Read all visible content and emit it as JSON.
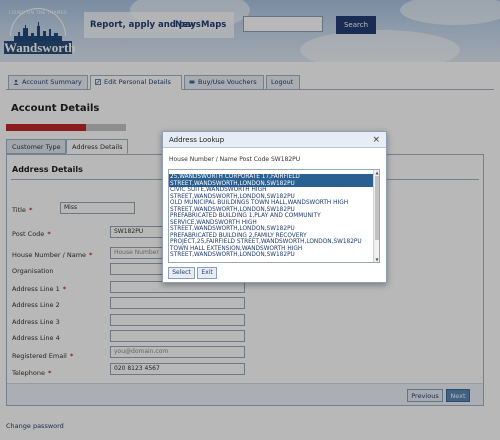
{
  "header": {
    "logo_arc_text": "LIVING ON THE THAMES",
    "logo_name": "Wandsworth",
    "links": [
      "Report, apply and pay",
      "News",
      "Maps"
    ],
    "search_button": "Search",
    "search_placeholder": ""
  },
  "main_nav": {
    "tabs": [
      {
        "label": "Account Summary",
        "icon": "person-icon"
      },
      {
        "label": "Edit Personal Details",
        "icon": "edit-icon"
      },
      {
        "label": "Buy/Use Vouchers",
        "icon": "voucher-icon"
      },
      {
        "label": "Logout",
        "icon": ""
      }
    ],
    "active_index": 1
  },
  "page_title": "Account Details",
  "progress": {
    "fraction": 0.67,
    "fill_color": "#c0282d"
  },
  "form_tabs": [
    "Customer Type",
    "Address Details"
  ],
  "form": {
    "section_title": "Address Details",
    "fields": [
      {
        "label": "Title",
        "required": true,
        "value": "Miss"
      },
      {
        "label": "Post Code",
        "required": true,
        "value": "SW182PU"
      },
      {
        "label": "House Number / Name",
        "required": true,
        "placeholder": "House Number"
      },
      {
        "label": "Organisation",
        "required": false,
        "value": ""
      },
      {
        "label": "Address Line 1",
        "required": true,
        "value": ""
      },
      {
        "label": "Address Line 2",
        "required": false,
        "value": ""
      },
      {
        "label": "Address Line 3",
        "required": false,
        "value": ""
      },
      {
        "label": "Address Line 4",
        "required": false,
        "value": ""
      },
      {
        "label": "Registered Email",
        "required": true,
        "placeholder": "you@domain.com"
      },
      {
        "label": "Telephone",
        "required": true,
        "value": "020 8123 4567"
      }
    ],
    "buttons": {
      "previous": "Previous",
      "next": "Next"
    }
  },
  "change_password": "Change password",
  "modal": {
    "title": "Address Lookup",
    "close": "×",
    "subtitle": "House Number / Name Post Code SW182PU",
    "addresses": [
      "25,WANDSWORTH CORPORATE 17,FAIRFIELD STREET,WANDSWORTH,LONDON,SW182PU",
      "CIVIC SUITE,WANDSWORTH HIGH STREET,WANDSWORTH,LONDON,SW182PU",
      "OLD MUNICIPAL BUILDINGS TOWN HALL,WANDSWORTH HIGH STREET,WANDSWORTH,LONDON,SW182PU",
      "PREFABRICATED BUILDING 1,PLAY AND COMMUNITY SERVICE,WANDSWORTH HIGH STREET,WANDSWORTH,LONDON,SW182PU",
      "PREFABRICATED BUILDING 2,FAMILY RECOVERY PROJECT,25,FAIRFIELD STREET,WANDSWORTH,LONDON,SW182PU",
      "TOWN HALL EXTENSION,WANDSWORTH HIGH STREET,WANDSWORTH,LONDON,SW182PU"
    ],
    "selected_index": 0,
    "select_button": "Select",
    "exit_button": "Exit"
  }
}
